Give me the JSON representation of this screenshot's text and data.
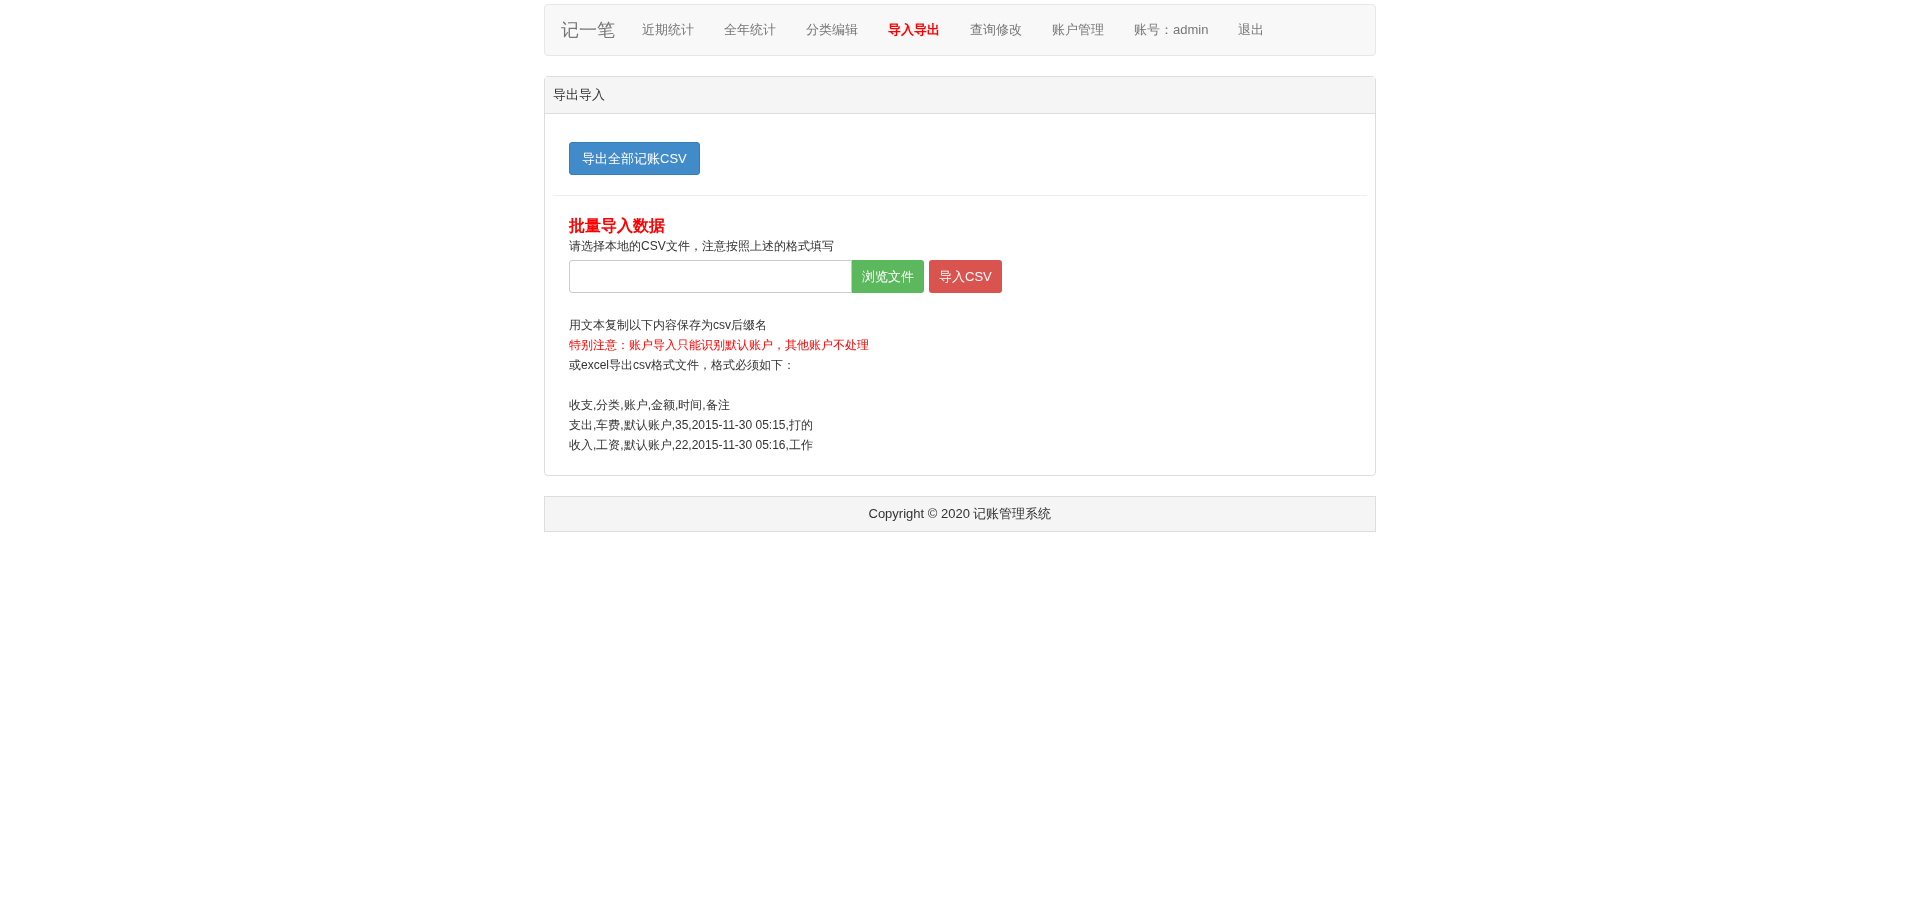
{
  "navbar": {
    "brand": "记一笔",
    "items": [
      {
        "label": "近期统计",
        "selected": false
      },
      {
        "label": "全年统计",
        "selected": false
      },
      {
        "label": "分类编辑",
        "selected": false
      },
      {
        "label": "导入导出",
        "selected": true
      },
      {
        "label": "查询修改",
        "selected": false
      },
      {
        "label": "账户管理",
        "selected": false
      },
      {
        "label": "账号：admin",
        "selected": false
      },
      {
        "label": "退出",
        "selected": false
      }
    ]
  },
  "panel": {
    "title": "导出导入",
    "export_button": "导出全部记账CSV",
    "import": {
      "heading": "批量导入数据",
      "hint": "请选择本地的CSV文件，注意按照上述的格式填写",
      "browse_button": "浏览文件",
      "import_button": "导入CSV"
    },
    "notes": [
      [
        {
          "text": "用文本复制以下内容保存为csv后缀名",
          "kind": "normal"
        },
        {
          "text": "特别注意：账户导入只能识别默认账户，其他账户不处理",
          "kind": "warning"
        },
        {
          "text": "或excel导出csv格式文件，格式必须如下：",
          "kind": "normal"
        }
      ],
      [
        {
          "text": "收支,分类,账户,金额,时间,备注",
          "kind": "normal"
        },
        {
          "text": "支出,车费,默认账户,35,2015-11-30 05:15,打的",
          "kind": "normal"
        },
        {
          "text": "收入,工资,默认账户,22,2015-11-30 05:16,工作",
          "kind": "normal"
        }
      ]
    ]
  },
  "footer": "Copyright © 2020 记账管理系统"
}
